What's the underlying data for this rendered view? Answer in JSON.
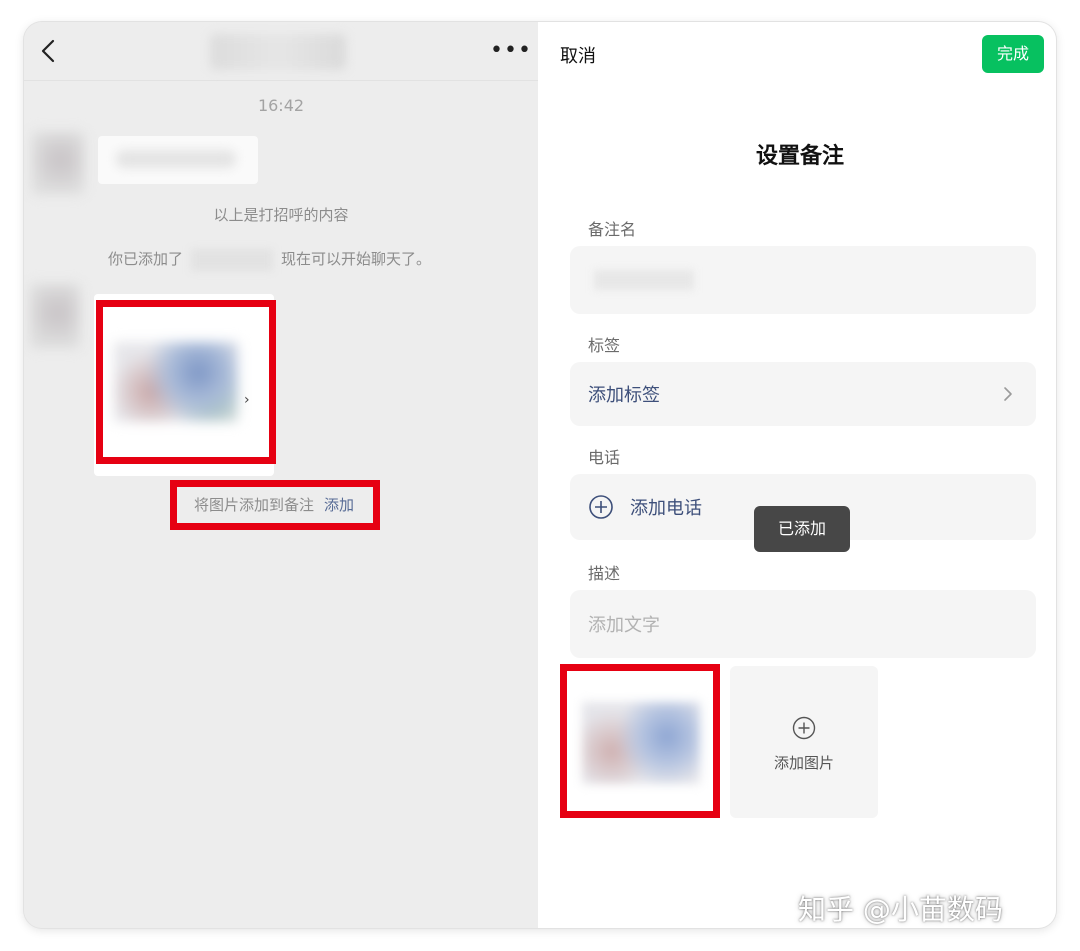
{
  "chat": {
    "time": "16:42",
    "greeting_notice": "以上是打招呼的内容",
    "added_notice_prefix": "你已添加了",
    "added_notice_suffix": "现在可以开始聊天了。",
    "image_hint": "将图片添加到备注",
    "image_hint_action": "添加"
  },
  "remark": {
    "cancel_label": "取消",
    "done_label": "完成",
    "title": "设置备注",
    "remark_name_label": "备注名",
    "tags_label": "标签",
    "add_tag": "添加标签",
    "phone_label": "电话",
    "add_phone": "添加电话",
    "description_label": "描述",
    "add_text_placeholder": "添加文字",
    "add_photo": "添加图片",
    "toast": "已添加"
  },
  "watermark": "知乎 @小苗数码",
  "colors": {
    "accent_green": "#07c160",
    "link_blue": "#576b95",
    "highlight_red": "#e60012"
  }
}
